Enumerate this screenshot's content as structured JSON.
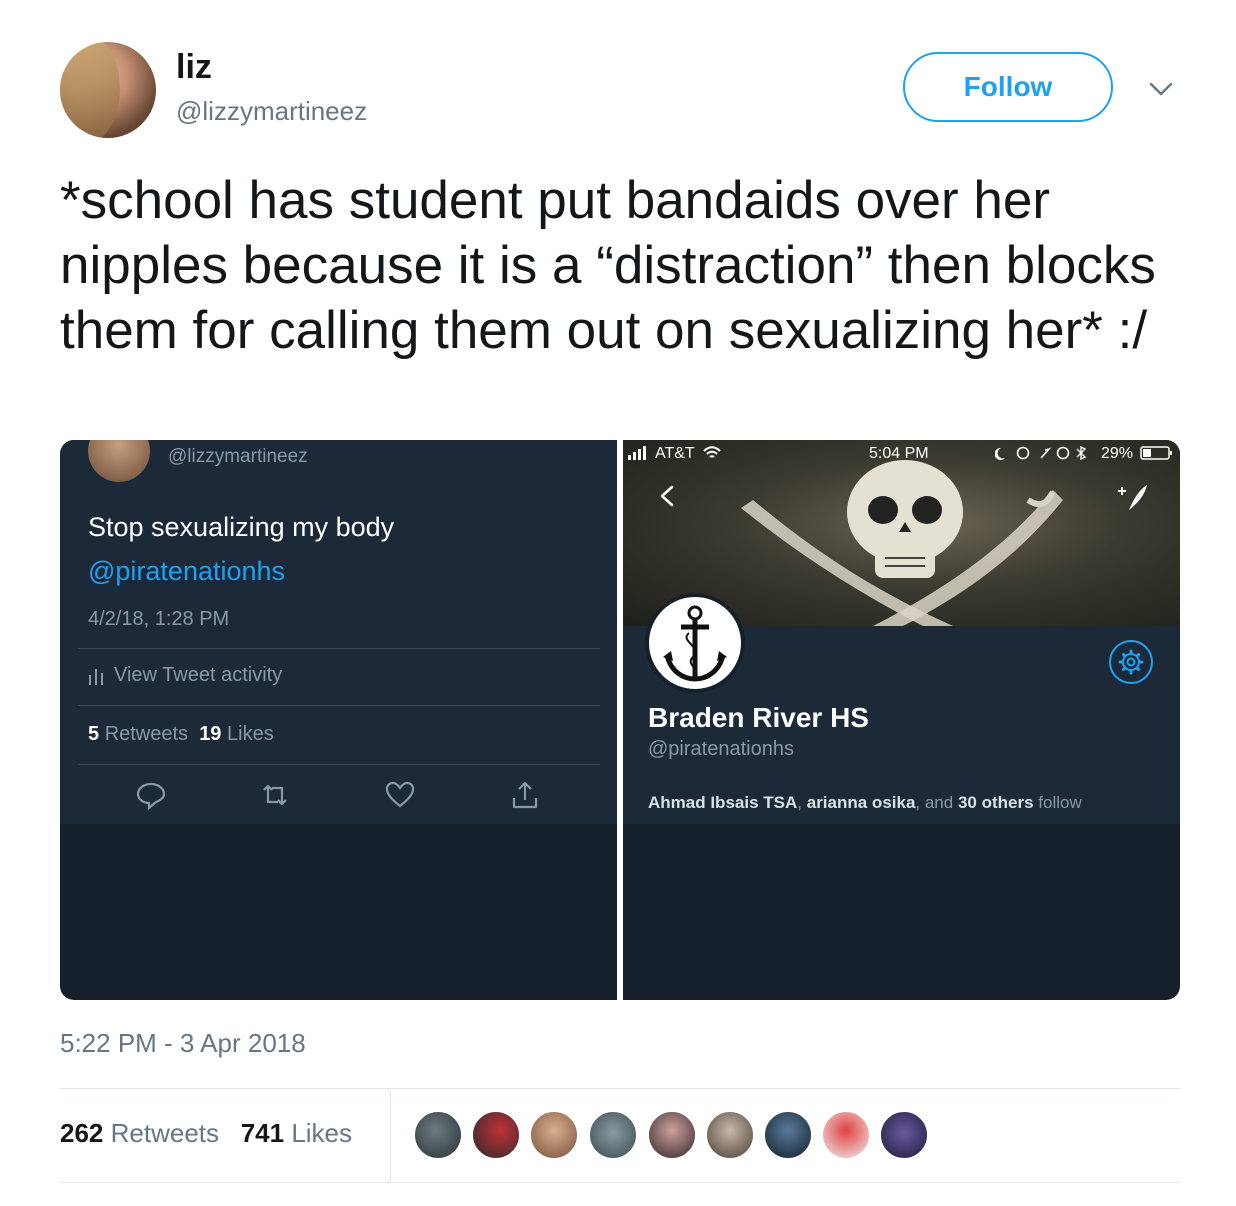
{
  "author": {
    "name": "liz",
    "handle": "@lizzymartineez"
  },
  "follow_label": "Follow",
  "tweet_text": "*school has student put bandaids over her nipples because it is a “distraction” then blocks them for calling them out on sexualizing her* :/",
  "media_left": {
    "handle": "@lizzymartineez",
    "text": "Stop sexualizing my body",
    "mention": "@piratenationhs",
    "time": "4/2/18, 1:28 PM",
    "activity": "View Tweet activity",
    "retweets_count": "5",
    "retweets_label": "Retweets",
    "likes_count": "19",
    "likes_label": "Likes"
  },
  "media_right": {
    "carrier": "AT&T",
    "clock": "5:04 PM",
    "battery": "29%",
    "name": "Braden River HS",
    "handle": "@piratenationhs",
    "follow_1": "Ahmad Ibsais TSA",
    "follow_sep1": ",",
    "follow_2": "arianna osika",
    "follow_sep2": ", and",
    "follow_3": "30 others",
    "follow_end": "follow"
  },
  "timestamp": "5:22 PM - 3 Apr 2018",
  "stats": {
    "retweets_count": "262",
    "retweets_label": "Retweets",
    "likes_count": "741",
    "likes_label": "Likes"
  },
  "colors": {
    "accent": "#1da1f2",
    "dark_bg": "#15202b",
    "muted": "#657786"
  }
}
